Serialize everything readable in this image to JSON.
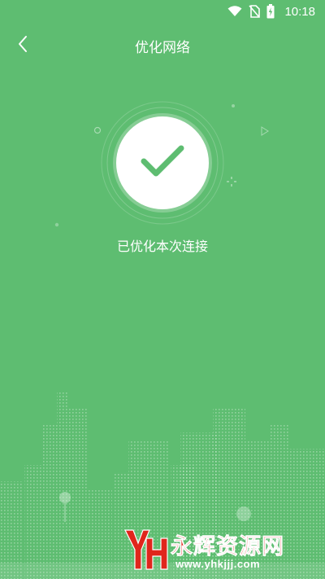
{
  "status_bar": {
    "time": "10:18",
    "icons": [
      "wifi-icon",
      "no-sim-icon",
      "battery-charging-icon"
    ]
  },
  "header": {
    "title": "优化网络",
    "back_icon": "chevron-left-icon"
  },
  "result": {
    "icon": "checkmark-icon",
    "message": "已优化本次连接"
  },
  "watermark": {
    "name": "永辉资源网",
    "url": "www.yhkjjj.com"
  },
  "colors": {
    "background": "#5ebd71",
    "check": "#5ebd71",
    "watermark_red": "#e0261c"
  }
}
